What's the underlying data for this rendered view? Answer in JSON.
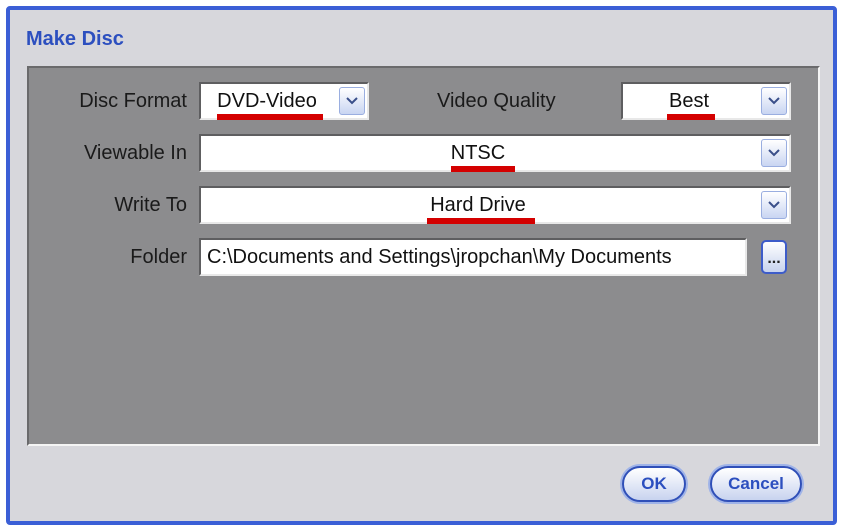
{
  "window": {
    "title": "Make Disc"
  },
  "form": {
    "disc_format": {
      "label": "Disc Format",
      "value": "DVD-Video"
    },
    "video_quality": {
      "label": "Video Quality",
      "value": "Best"
    },
    "viewable_in": {
      "label": "Viewable In",
      "value": "NTSC"
    },
    "write_to": {
      "label": "Write To",
      "value": "Hard Drive"
    },
    "folder": {
      "label": "Folder",
      "value": "C:\\Documents and Settings\\jropchan\\My Documents",
      "browse_label": "..."
    }
  },
  "buttons": {
    "ok_label": "OK",
    "cancel_label": "Cancel"
  },
  "icons": {
    "dropdown": "chevron-down-icon",
    "browse": "ellipsis-icon"
  },
  "colors": {
    "accent": "#2c4fbf",
    "annotation": "#d40000",
    "panel": "#8c8c8e"
  }
}
